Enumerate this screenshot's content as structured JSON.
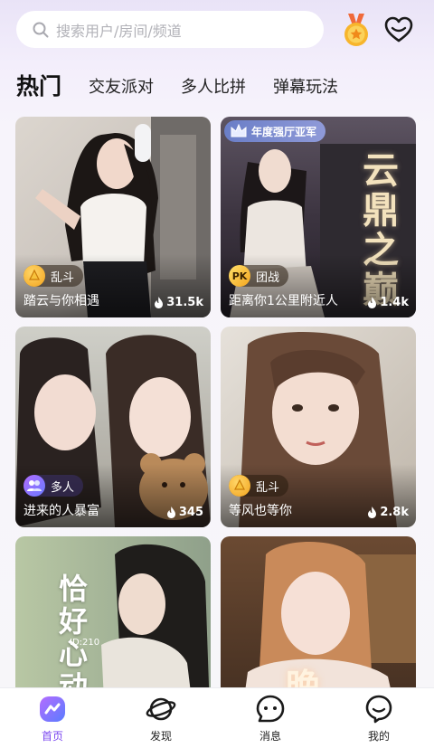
{
  "search": {
    "placeholder": "搜索用户/房间/频道"
  },
  "tabs": [
    {
      "label": "热门",
      "active": true
    },
    {
      "label": "交友派对"
    },
    {
      "label": "多人比拼"
    },
    {
      "label": "弹幕玩法"
    }
  ],
  "rooms": [
    {
      "badge": "乱斗",
      "badge_icon": "chaos-fight-icon",
      "title": "踏云与你相遇",
      "heat": "31.5k"
    },
    {
      "banner": "年度强厅亚军",
      "poster_text": "云鼎之巅",
      "badge": "团战",
      "badge_icon": "pk-icon",
      "badge_icon_text": "PK",
      "title": "距离你1公里附近人",
      "heat": "1.4k"
    },
    {
      "badge": "多人",
      "badge_icon": "multi-user-icon",
      "title": "进来的人暴富",
      "heat": "345"
    },
    {
      "badge": "乱斗",
      "badge_icon": "chaos-fight-icon",
      "title": "等风也等你",
      "heat": "2.8k"
    },
    {
      "poster_text": "恰好心动",
      "poster_sub": "ID:210"
    },
    {
      "poster_text": "晚"
    }
  ],
  "bottom_nav": [
    {
      "label": "首页",
      "icon": "home-icon",
      "active": true
    },
    {
      "label": "发现",
      "icon": "planet-icon"
    },
    {
      "label": "消息",
      "icon": "message-icon"
    },
    {
      "label": "我的",
      "icon": "profile-icon"
    }
  ],
  "colors": {
    "accent": "#7a46f0",
    "badge_gold": "#f5b52a"
  }
}
